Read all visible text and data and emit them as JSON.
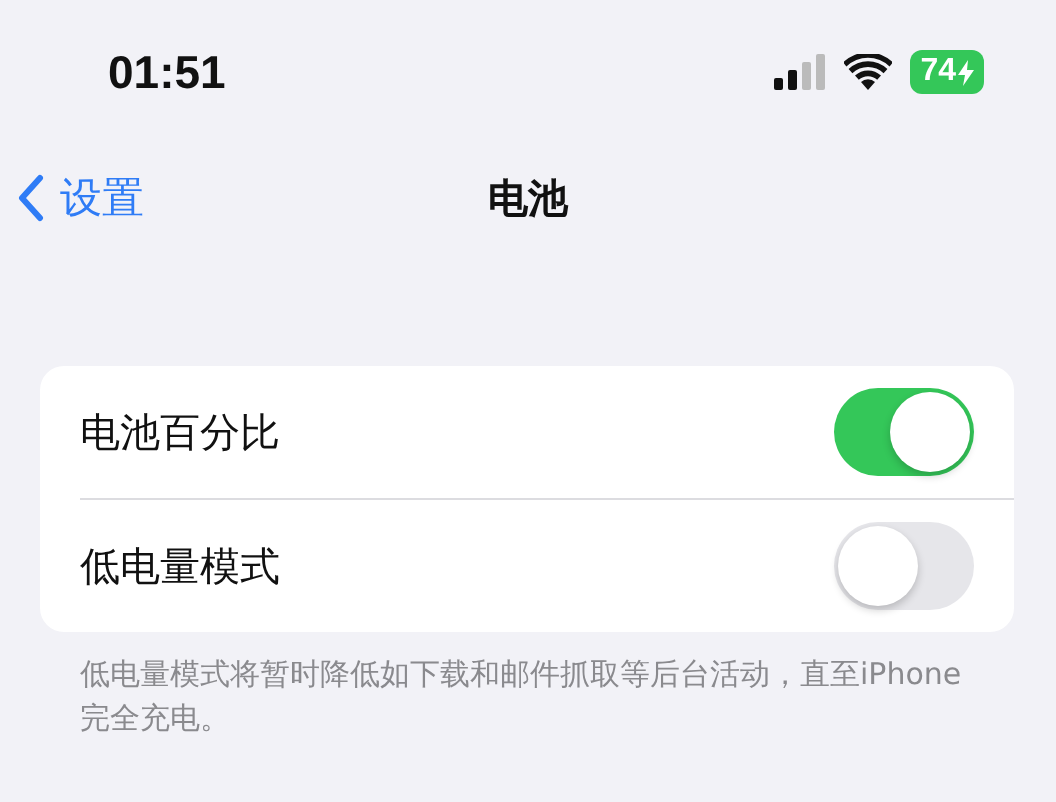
{
  "status_bar": {
    "time": "01:51",
    "battery": "74"
  },
  "nav": {
    "back_label": "设置",
    "title": "电池"
  },
  "rows": [
    {
      "label": "电池百分比",
      "on": true
    },
    {
      "label": "低电量模式",
      "on": false
    }
  ],
  "footer": "低电量模式将暂时降低如下载和邮件抓取等后台活动，直至iPhone完全充电。"
}
